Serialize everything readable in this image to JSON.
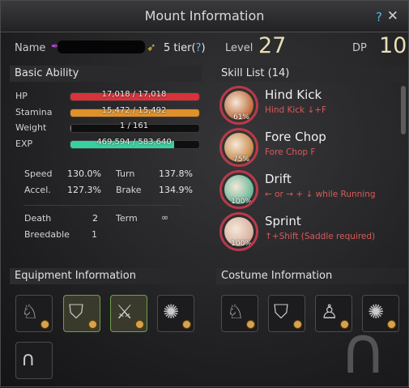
{
  "window": {
    "title": "Mount Information",
    "help": "?",
    "close": "✕"
  },
  "info": {
    "name_label": "Name",
    "tier": "5 tier(",
    "tier_q": "?",
    "tier_close": ")",
    "level_label": "Level",
    "level": "27",
    "dp_label": "DP",
    "dp": "10"
  },
  "basic": {
    "title": "Basic Ability",
    "bars": [
      {
        "label": "HP",
        "value": "17,018 / 17,018",
        "fraction": 1.0,
        "color": "#d8323a"
      },
      {
        "label": "Stamina",
        "value": "15,472 / 15,492",
        "fraction": 0.999,
        "color": "#e0902a"
      },
      {
        "label": "Weight",
        "value": "1 / 161",
        "fraction": 0.006,
        "color": "#8a8a8a"
      },
      {
        "label": "EXP",
        "value": "469,594 / 583,640",
        "fraction": 0.805,
        "color": "#38d0a0"
      }
    ],
    "speed_label": "Speed",
    "speed": "130.0%",
    "turn_label": "Turn",
    "turn": "137.8%",
    "accel_label": "Accel.",
    "accel": "127.3%",
    "brake_label": "Brake",
    "brake": "134.9%",
    "death_label": "Death",
    "death": "2",
    "term_label": "Term",
    "term": "∞",
    "breedable_label": "Breedable",
    "breedable": "1"
  },
  "skills": {
    "title": "Skill List (14)",
    "items": [
      {
        "name": "Hind Kick",
        "desc": "Hind Kick ↓+F",
        "pct": "61%",
        "icon": "hind-kick-icon",
        "color": "#c06a3a"
      },
      {
        "name": "Fore Chop",
        "desc": "Fore Chop F",
        "pct": "75%",
        "icon": "fore-chop-icon",
        "color": "#c88a4a"
      },
      {
        "name": "Drift",
        "desc": "← or → + ↓ while Running",
        "pct": "100%",
        "icon": "drift-icon",
        "color": "#6ab89a"
      },
      {
        "name": "Sprint",
        "desc": "↑+Shift (Saddle required)",
        "pct": "100%",
        "icon": "sprint-icon",
        "color": "#d8b0a0"
      }
    ]
  },
  "equipment": {
    "title": "Equipment Information"
  },
  "costume": {
    "title": "Costume Information"
  }
}
